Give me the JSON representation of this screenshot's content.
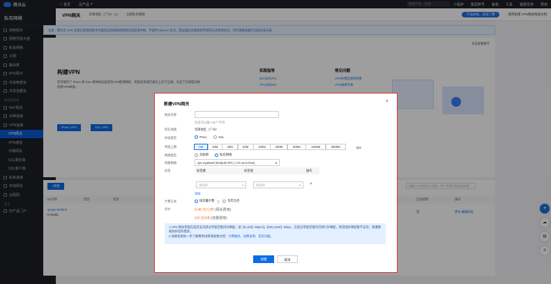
{
  "topbar": {
    "brand": "腾讯云",
    "home": "首页",
    "console": "总产品",
    "search_placeholder": "搜索产品、文档...",
    "mini": "小程序",
    "group": "集团账号",
    "record": "备案",
    "tools": "工具",
    "support": "客服支持",
    "cost": "费用"
  },
  "sidebar": {
    "title": "私有网络",
    "items": [
      "网络拓扑",
      "网络性能大盘",
      "私有网络",
      "子网",
      "路由表",
      "IP与网卡",
      "共享带宽包",
      "共享流量包"
    ],
    "section_cross": "跨地域连接",
    "cross_items": [
      "NAT网关",
      "对等连接"
    ],
    "vpn": "VPN连接",
    "vpn_sub": [
      "VPN网关",
      "VPN通道",
      "对端网关",
      "SSL服务端",
      "SSL客户端"
    ],
    "more": [
      "私有连接",
      "专线网关",
      "云联网"
    ],
    "section_sec": "安全",
    "bottom": "旧产品门户"
  },
  "main": {
    "title": "VPN网关",
    "region": "华南地区（广州）(1)",
    "vpc": "全部私有网络",
    "pill": "产品体验，您说了算",
    "right": "使用指南  VPN网关帮助文档"
  },
  "notice": "注意：腾讯云 VPN 连接在跨境场景中可能因运营商网络限制出现连接中断，不提供 Internet 访问，建议通过云联网或专线等方式跨境访问。同时请确保遵守当地法律法规。",
  "intro": {
    "demo": "点击观看教学",
    "title": "构建VPN",
    "desc": "您可提供了 IPSec 和 SSL 两种协议类型的VPN使用教程，帮助您快速打通云上云下互通，点击下方按钮开始创建VPN网关。",
    "btn1": "IPsec VPN",
    "btn2": "SSL VPN",
    "col1_title": "实践指导",
    "col1": [
      "IDC访问VPC",
      "VPC访问IDC"
    ],
    "col2_title": "常见问题",
    "col2": [
      "VPN有哪些使用场景",
      "VPN通道不通"
    ]
  },
  "list": {
    "new": "+新建",
    "search": "请输入VPN网关ID/名称，多个关键字用竖线|分隔",
    "headers": [
      "ID/名称",
      "监控",
      "状态",
      "所属网络",
      "带宽",
      "协议",
      "到期时间",
      "自动续费",
      "操作"
    ],
    "row": {
      "id": "vpngw-9stf5nrl",
      "name": "to-baidu",
      "status": "无",
      "ops": "更多 编辑标签"
    }
  },
  "modal": {
    "title": "新建VPN网关",
    "name_label": "网关名称",
    "name_hint": "您还可以输入60个字符",
    "region_label": "所在地域",
    "region_value": "华南地区（广州）",
    "protocol_label": "协议类型",
    "protocol_options": [
      "IPsec",
      "SSL"
    ],
    "bw_label": "带宽上限",
    "bw_options": [
      "5M",
      "10M",
      "20M",
      "50M",
      "100M",
      "200M",
      "500M",
      "1000M",
      "3000M"
    ],
    "bw_unit": "bps",
    "type_label": "网络类型",
    "type_options": [
      "云联网",
      "私有网络"
    ],
    "vpc_label": "所属网络",
    "vpc_value": "vpc-eyat6o0f (Default-VPC | 172.16.0.0/16)",
    "tag_label": "标签",
    "tag_key": "标签键",
    "tag_value": "标签值",
    "tag_op": "操作",
    "tag_key_ph": "请选择",
    "tag_val_ph": "请选择",
    "tag_add": "添加",
    "billing_label": "计费方式",
    "billing_options": [
      "按流量计费",
      "包年包月"
    ],
    "price_label": "总价",
    "price1": "0.48 元/小时",
    "price1_note": "(网关费用)",
    "price2": "0.8 元/GB",
    "price2_note": "(流量费用)",
    "info1": "1 VPN 网关带宽在前后支持部分带宽范围内升降配，如【5,100】Mbps与【200,1000】Mbps，在各自带宽范围内可进行升降配，跨范围升降配暂不支持，请谨慎规划好您的需求。",
    "info2": "2 如果您想进一步了解费用详情请查看文档：",
    "info_links": [
      "计费概述",
      "退费说明",
      "常见问题"
    ],
    "ok": "创建",
    "cancel": "取消"
  }
}
